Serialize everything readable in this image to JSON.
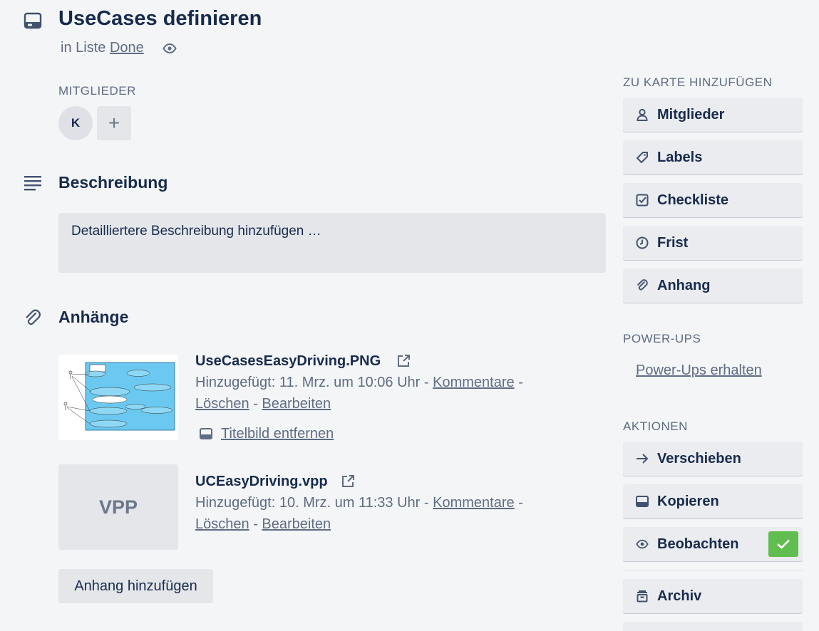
{
  "card": {
    "title": "UseCases definieren",
    "list_prefix": "in Liste",
    "list_name": "Done"
  },
  "members": {
    "label": "MITGLIEDER",
    "avatar_initial": "K",
    "add_symbol": "+"
  },
  "description": {
    "heading": "Beschreibung",
    "placeholder": "Detailliertere Beschreibung hinzufügen …"
  },
  "attachments": {
    "heading": "Anhänge",
    "items": [
      {
        "name": "UseCasesEasyDriving.PNG",
        "added": "Hinzugefügt: 11. Mrz. um 10:06 Uhr",
        "comments": "Kommentare",
        "delete": "Löschen",
        "edit": "Bearbeiten",
        "cover_action": "Titelbild entfernen"
      },
      {
        "name": "UCEasyDriving.vpp",
        "thumb_label": "VPP",
        "added": "Hinzugefügt: 10. Mrz. um 11:33 Uhr",
        "comments": "Kommentare",
        "delete": "Löschen",
        "edit": "Bearbeiten"
      }
    ],
    "separator": "-",
    "add_button": "Anhang hinzufügen"
  },
  "sidebar": {
    "add_to_card_label": "ZU KARTE HINZUFÜGEN",
    "add_items": [
      {
        "label": "Mitglieder",
        "icon": "person-icon"
      },
      {
        "label": "Labels",
        "icon": "tag-icon"
      },
      {
        "label": "Checkliste",
        "icon": "checkbox-icon"
      },
      {
        "label": "Frist",
        "icon": "clock-icon"
      },
      {
        "label": "Anhang",
        "icon": "paperclip-icon"
      }
    ],
    "powerups_label": "POWER-UPS",
    "powerups_link": "Power-Ups erhalten",
    "actions_label": "AKTIONEN",
    "action_items": [
      {
        "label": "Verschieben",
        "icon": "arrow-right-icon"
      },
      {
        "label": "Kopieren",
        "icon": "card-icon"
      },
      {
        "label": "Beobachten",
        "icon": "eye-icon",
        "checked": true
      },
      {
        "label": "Archiv",
        "icon": "archive-icon"
      }
    ]
  },
  "colors": {
    "background": "#f4f5f7",
    "text": "#172b4d",
    "muted": "#5e6c84",
    "button": "#ebecf0",
    "success": "#61bd4f",
    "thumb_blue": "#6bc9f1"
  }
}
